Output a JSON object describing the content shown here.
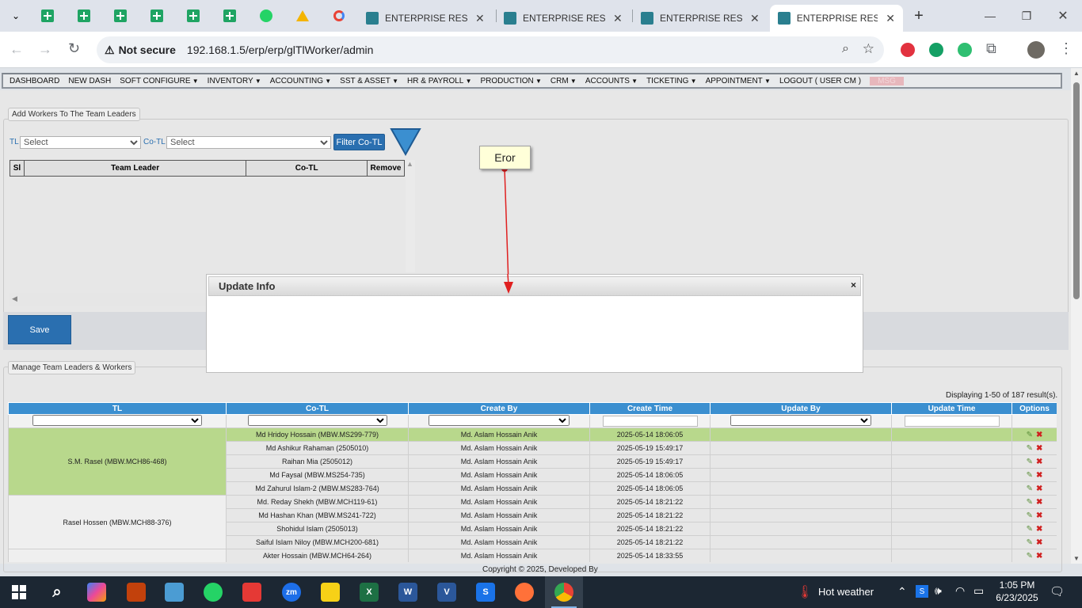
{
  "browser": {
    "tabs": [
      {
        "title": "ENTERPRISE RESOU"
      },
      {
        "title": "ENTERPRISE RESOU"
      },
      {
        "title": "ENTERPRISE RESOU"
      },
      {
        "title": "ENTERPRISE RESOU"
      }
    ],
    "security_label": "Not secure",
    "url": "192.168.1.5/erp/erp/glTlWorker/admin"
  },
  "menu": {
    "items": [
      "DASHBOARD",
      "NEW DASH",
      "SOFT CONFIGURE",
      "INVENTORY",
      "ACCOUNTING",
      "SST & ASSET",
      "HR & PAYROLL",
      "PRODUCTION",
      "CRM",
      "ACCOUNTS",
      "TICKETING",
      "APPOINTMENT",
      "LOGOUT ( USER CM )",
      "MSG"
    ]
  },
  "add_section": {
    "legend": "Add Workers To The Team Leaders",
    "tl_label": "TL",
    "tl_placeholder": "Select",
    "cotl_label": "Co-TL",
    "cotl_placeholder": "Select",
    "filter_button": "Filter Co-TL",
    "table_headers": [
      "Sl",
      "Team Leader",
      "Co-TL",
      "Remove"
    ],
    "save_button": "Save"
  },
  "annotation": {
    "callout": "Eror"
  },
  "modal": {
    "title": "Update Info",
    "close": "×"
  },
  "manage_section": {
    "legend": "Manage Team Leaders & Workers",
    "result_count": "Displaying 1-50 of 187 result(s).",
    "headers": [
      "TL",
      "Co-TL",
      "Create By",
      "Create Time",
      "Update By",
      "Update Time",
      "Options"
    ],
    "groups": [
      {
        "tl": "S.M. Rasel (MBW.MCH86-468)",
        "rows": [
          {
            "cotl": "Md Hridoy Hossain (MBW.MS299-779)",
            "by": "Md. Aslam Hossain Anik",
            "time": "2025-05-14 18:06:05"
          },
          {
            "cotl": "Md Ashikur Rahaman (2505010)",
            "by": "Md. Aslam Hossain Anik",
            "time": "2025-05-19 15:49:17"
          },
          {
            "cotl": "Raihan Mia (2505012)",
            "by": "Md. Aslam Hossain Anik",
            "time": "2025-05-19 15:49:17"
          },
          {
            "cotl": "Md Faysal (MBW.MS254-735)",
            "by": "Md. Aslam Hossain Anik",
            "time": "2025-05-14 18:06:05"
          },
          {
            "cotl": "Md Zahurul Islam-2 (MBW.MS283-764)",
            "by": "Md. Aslam Hossain Anik",
            "time": "2025-05-14 18:06:05"
          }
        ]
      },
      {
        "tl": "Rasel Hossen (MBW.MCH88-376)",
        "rows": [
          {
            "cotl": "Md. Reday Shekh (MBW.MCH119-61)",
            "by": "Md. Aslam Hossain Anik",
            "time": "2025-05-14 18:21:22"
          },
          {
            "cotl": "Md Hashan Khan (MBW.MS241-722)",
            "by": "Md. Aslam Hossain Anik",
            "time": "2025-05-14 18:21:22"
          },
          {
            "cotl": "Shohidul Islam (2505013)",
            "by": "Md. Aslam Hossain Anik",
            "time": "2025-05-14 18:21:22"
          },
          {
            "cotl": "Saiful Islam Niloy (MBW.MCH200-681)",
            "by": "Md. Aslam Hossain Anik",
            "time": "2025-05-14 18:21:22"
          }
        ]
      },
      {
        "tl": "",
        "rows": [
          {
            "cotl": "Akter Hossain (MBW.MCH64-264)",
            "by": "Md. Aslam Hossain Anik",
            "time": "2025-05-14 18:33:55"
          }
        ]
      }
    ]
  },
  "footer": {
    "copyright": "Copyright © 2025, Developed By"
  },
  "taskbar": {
    "weather": "Hot weather",
    "time": "1:05 PM",
    "date": "6/23/2025"
  }
}
